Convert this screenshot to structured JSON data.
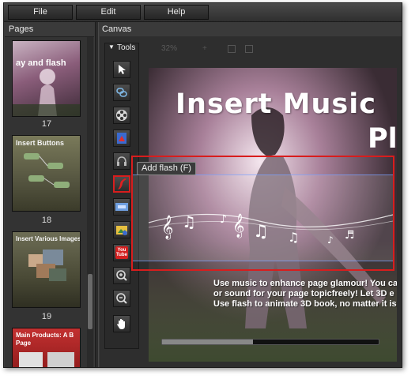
{
  "menu": {
    "file": "File",
    "edit": "Edit",
    "help": "Help"
  },
  "panels": {
    "pages_label": "Pages",
    "canvas_label": "Canvas"
  },
  "pages": [
    {
      "number": "17",
      "title": "ay and flash"
    },
    {
      "number": "18",
      "title": "Insert Buttons"
    },
    {
      "number": "19",
      "title": "Insert Various Images"
    },
    {
      "number": "",
      "title": "Main Products: A B Page"
    }
  ],
  "tools": {
    "header": "Tools",
    "items": [
      {
        "name": "select-arrow-icon"
      },
      {
        "name": "link-icon"
      },
      {
        "name": "video-reel-icon"
      },
      {
        "name": "image-icon"
      },
      {
        "name": "headphones-icon"
      },
      {
        "name": "flash-icon"
      },
      {
        "name": "flash-text-icon"
      },
      {
        "name": "picture-gallery-icon"
      },
      {
        "name": "youtube-icon",
        "label_top": "You",
        "label_bottom": "Tube"
      },
      {
        "name": "zoom-in-icon"
      },
      {
        "name": "zoom-out-icon"
      },
      {
        "name": "hand-pan-icon"
      }
    ]
  },
  "zoom": {
    "value": "32%"
  },
  "tooltip": {
    "text": "Add flash (F)"
  },
  "page_content": {
    "title_line1": "Insert Music",
    "title_line2": "Pl",
    "body_lines": [
      "Use music to enhance page glamour! You can",
      "or sound for your page topicfreely! Let 3D e",
      "Use flash to animate 3D book, no matter it is"
    ]
  },
  "colors": {
    "highlight_red": "#d81d1d",
    "tooltip_border": "#8a8a8a",
    "app_bg": "#3a3a3a"
  }
}
